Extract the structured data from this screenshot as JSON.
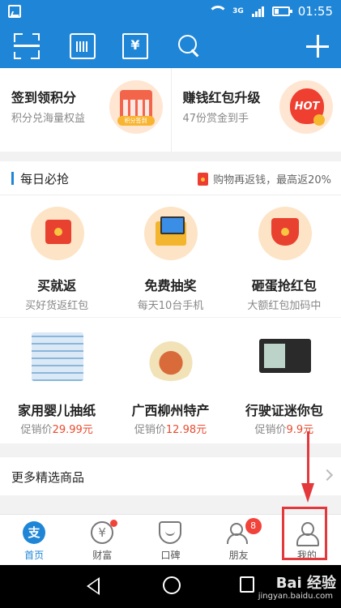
{
  "status_bar": {
    "network": "3G",
    "time": "01:55"
  },
  "promo": [
    {
      "title": "签到领积分",
      "subtitle": "积分兑海量权益",
      "badge": "积分签到",
      "icon": "calendar-icon"
    },
    {
      "title": "赚钱红包升级",
      "subtitle": "47份赏金到手",
      "badge": "HOT",
      "icon": "hot-fire-icon"
    }
  ],
  "section": {
    "title": "每日必抢",
    "right_text": "购物再返钱，最高返20%"
  },
  "grid_row1": [
    {
      "title": "买就返",
      "subtitle": "买好货返红包"
    },
    {
      "title": "免费抽奖",
      "subtitle": "每天10台手机"
    },
    {
      "title": "砸蛋抢红包",
      "subtitle": "大额红包加码中"
    }
  ],
  "grid_row2": [
    {
      "title": "家用婴儿抽纸",
      "price_prefix": "促销价",
      "price": "29.99元"
    },
    {
      "title": "广西柳州特产",
      "price_prefix": "促销价",
      "price": "12.98元"
    },
    {
      "title": "行驶证迷你包",
      "price_prefix": "促销价",
      "price": "9.9元"
    }
  ],
  "more": {
    "label": "更多精选商品"
  },
  "tabbar": [
    {
      "label": "首页",
      "glyph": "支",
      "active": true
    },
    {
      "label": "财富",
      "glyph": "¥"
    },
    {
      "label": "口碑"
    },
    {
      "label": "朋友",
      "badge": "8"
    },
    {
      "label": "我的"
    }
  ],
  "appbar": {
    "card_glyph": "¥"
  },
  "watermark": {
    "brand": "Bai 经验",
    "url": "jingyan.baidu.com"
  },
  "colors": {
    "primary": "#1f86d7",
    "accent_red": "#e84b2e",
    "annotation": "#e4393c"
  }
}
